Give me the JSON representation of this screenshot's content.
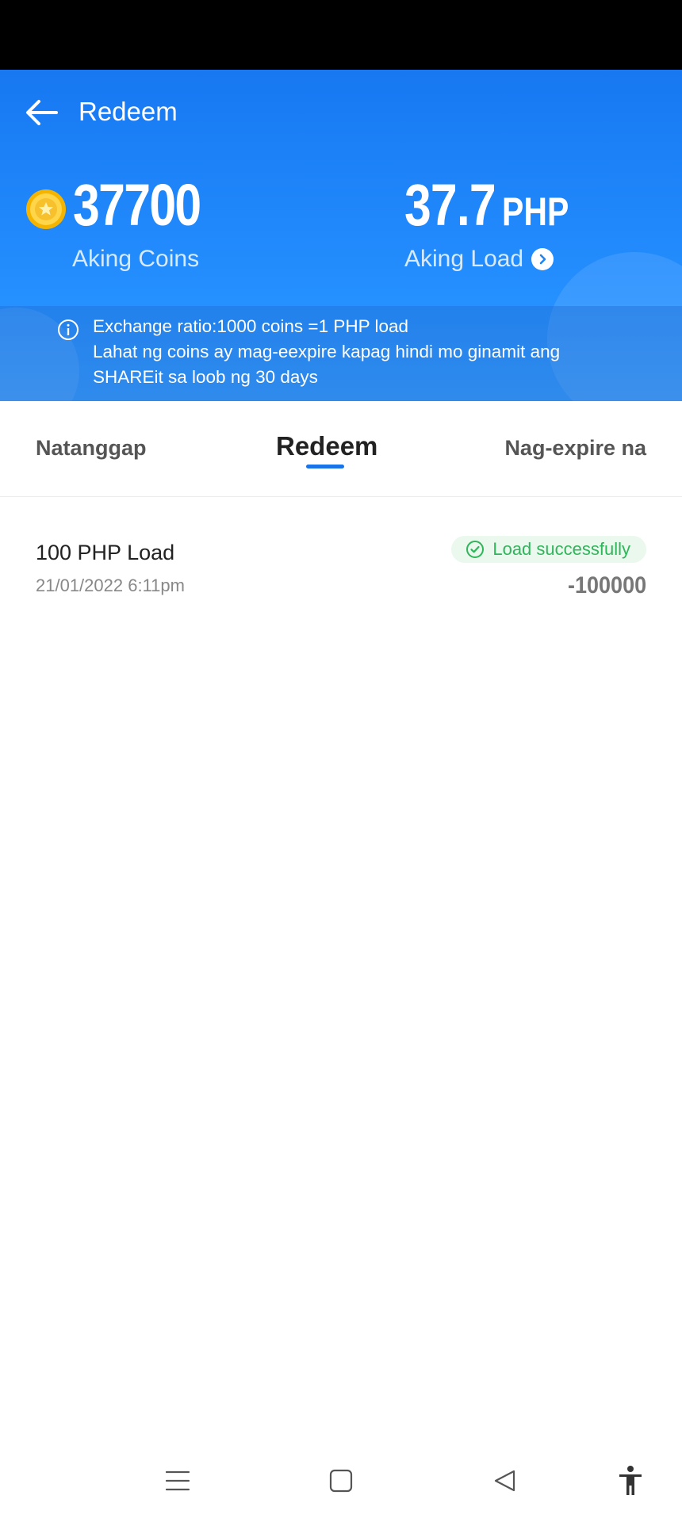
{
  "header": {
    "title": "Redeem"
  },
  "balance": {
    "coins_value": "37700",
    "coins_label": "Aking Coins",
    "load_value": "37.7",
    "load_unit": "PHP",
    "load_label": "Aking Load"
  },
  "notice": {
    "line1": "Exchange ratio:1000 coins =1 PHP load",
    "line2": "Lahat ng coins ay mag-eexpire kapag hindi mo ginamit ang",
    "line3": "SHAREit sa loob ng 30 days"
  },
  "tabs": [
    {
      "label": "Natanggap",
      "active": false
    },
    {
      "label": "Redeem",
      "active": true
    },
    {
      "label": "Nag-expire na",
      "active": false
    }
  ],
  "records": [
    {
      "title": "100 PHP Load",
      "date": "21/01/2022 6:11pm",
      "status": "Load successfully",
      "amount": "-100000"
    }
  ],
  "colors": {
    "header_blue": "#1778f2",
    "tab_indicator": "#1a73e8",
    "success_green": "#2fb55a",
    "success_bg": "#eaf8ee"
  },
  "icons": [
    "back-arrow-icon",
    "coin-icon",
    "chevron-right-icon",
    "info-icon",
    "check-circle-icon",
    "menu-icon",
    "home-square-icon",
    "back-triangle-icon",
    "accessibility-icon"
  ]
}
